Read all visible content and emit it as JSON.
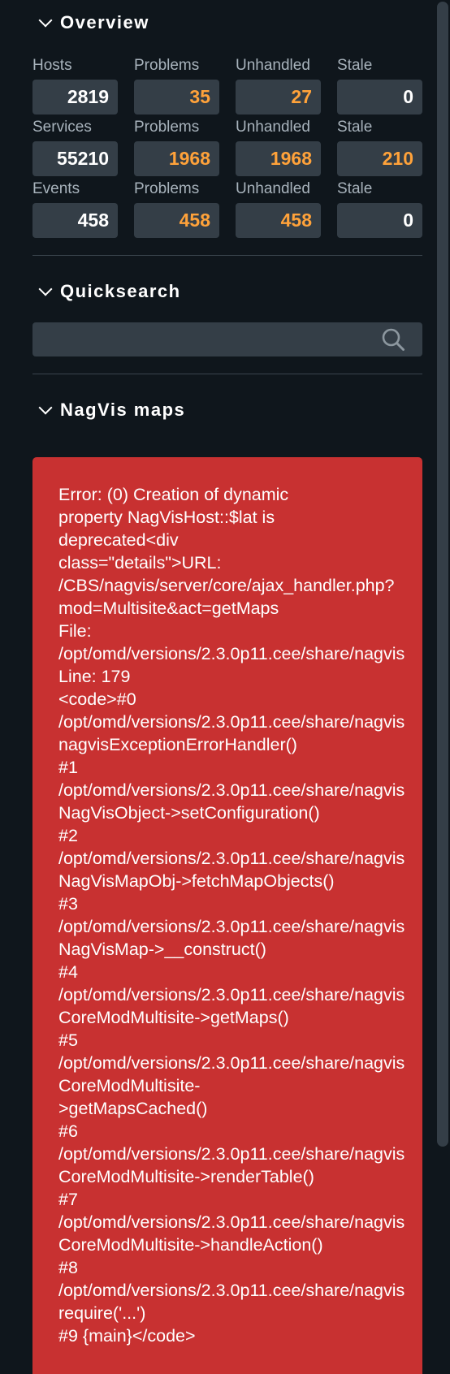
{
  "overview": {
    "title": "Overview",
    "rows": [
      {
        "labels": [
          "Hosts",
          "Problems",
          "Unhandled",
          "Stale"
        ],
        "values": [
          "2819",
          "35",
          "27",
          "0"
        ]
      },
      {
        "labels": [
          "Services",
          "Problems",
          "Unhandled",
          "Stale"
        ],
        "values": [
          "55210",
          "1968",
          "1968",
          "210"
        ]
      },
      {
        "labels": [
          "Events",
          "Problems",
          "Unhandled",
          "Stale"
        ],
        "values": [
          "458",
          "458",
          "458",
          "0"
        ]
      }
    ]
  },
  "quicksearch": {
    "title": "Quicksearch",
    "value": "",
    "placeholder": ""
  },
  "nagvis": {
    "title": "NagVis maps",
    "error_lines": [
      "Error: (0) Creation of dynamic",
      "property NagVisHost::$lat is",
      "deprecated<div",
      "class=\"details\">URL:",
      "/CBS/nagvis/server/core/ajax_handler.php?",
      "mod=Multisite&act=getMaps",
      "File:",
      "/opt/omd/versions/2.3.0p11.cee/share/nagvis",
      "Line: 179",
      "<code>#0",
      "/opt/omd/versions/2.3.0p11.cee/share/nagvis",
      "nagvisExceptionErrorHandler()",
      "#1",
      "/opt/omd/versions/2.3.0p11.cee/share/nagvis",
      "NagVisObject->setConfiguration()",
      "#2",
      "/opt/omd/versions/2.3.0p11.cee/share/nagvis",
      "NagVisMapObj->fetchMapObjects()",
      "#3",
      "/opt/omd/versions/2.3.0p11.cee/share/nagvis",
      "NagVisMap->__construct()",
      "#4",
      "/opt/omd/versions/2.3.0p11.cee/share/nagvis",
      "CoreModMultisite->getMaps()",
      "#5",
      "/opt/omd/versions/2.3.0p11.cee/share/nagvis",
      "CoreModMultisite-",
      ">getMapsCached()",
      "#6",
      "/opt/omd/versions/2.3.0p11.cee/share/nagvis",
      "CoreModMultisite->renderTable()",
      "#7",
      "/opt/omd/versions/2.3.0p11.cee/share/nagvis",
      "CoreModMultisite->handleAction()",
      "#8",
      "/opt/omd/versions/2.3.0p11.cee/share/nagvis",
      "require('...')",
      "#9 {main}</code>"
    ]
  },
  "colors": {
    "background": "#0f161c",
    "box": "#343e47",
    "label": "#a8b3bc",
    "warning": "#ffa23a",
    "error": "#c83131"
  }
}
